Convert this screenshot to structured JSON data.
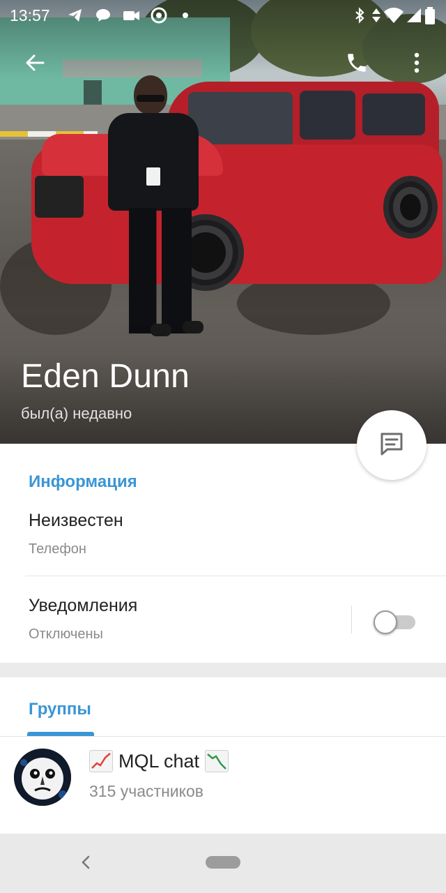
{
  "status_bar": {
    "time": "13:57",
    "left_icons": [
      "telegram-icon",
      "chat-bubble-icon",
      "video-camera-icon",
      "vpn-icon",
      "dot-icon"
    ],
    "right_icons": [
      "bluetooth-icon",
      "data-arrows-icon",
      "wifi-icon",
      "signal-icon",
      "battery-icon"
    ]
  },
  "appbar": {
    "back_icon": "arrow-left-icon",
    "call_icon": "phone-icon",
    "menu_icon": "more-vert-icon"
  },
  "profile": {
    "name": "Eden Dunn",
    "last_seen": "был(а) недавно"
  },
  "fab": {
    "icon": "message-icon"
  },
  "info": {
    "title": "Информация",
    "phone_value": "Неизвестен",
    "phone_label": "Телефон",
    "notifications_label": "Уведомления",
    "notifications_value": "Отключены",
    "notifications_enabled": false
  },
  "groups": {
    "title": "Группы",
    "items": [
      {
        "name": "MQL chat",
        "members": "315 участников",
        "prefix_emoji": "chart-increasing-icon",
        "suffix_emoji": "chart-decreasing-icon"
      }
    ]
  },
  "nav": {
    "back_icon": "nav-back-icon",
    "home_icon": "nav-home-pill"
  },
  "colors": {
    "accent": "#3a95d5",
    "car_red": "#c4232d"
  }
}
